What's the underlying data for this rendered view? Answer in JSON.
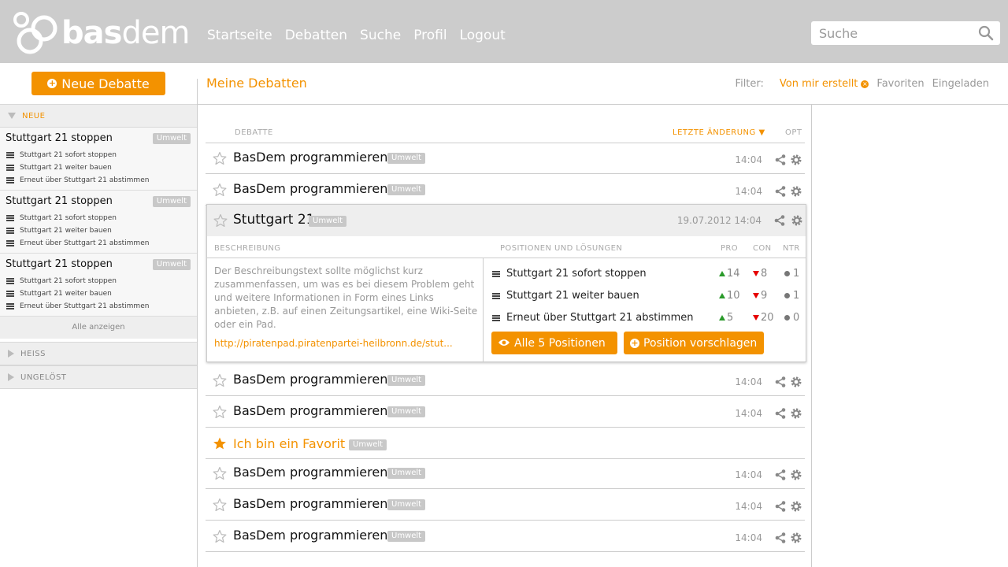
{
  "app": {
    "logo_bold": "bas",
    "logo_light": "dem"
  },
  "nav": [
    "Startseite",
    "Debatten",
    "Suche",
    "Profil",
    "Logout"
  ],
  "search": {
    "placeholder": "Suche"
  },
  "sidebar": {
    "new_button": "Neue Debatte",
    "sections": {
      "neue": "NEUE",
      "heiss": "HEISS",
      "ungeloest": "UNGELÖST"
    },
    "debates": [
      {
        "title": "Stuttgart 21 stoppen",
        "tag": "Umwelt",
        "positions": [
          "Stuttgart 21 sofort stoppen",
          "Stuttgart 21 weiter bauen",
          "Erneut über Stuttgart 21 abstimmen"
        ]
      },
      {
        "title": "Stuttgart 21 stoppen",
        "tag": "Umwelt",
        "positions": [
          "Stuttgart 21 sofort stoppen",
          "Stuttgart 21 weiter bauen",
          "Erneut über Stuttgart 21 abstimmen"
        ]
      },
      {
        "title": "Stuttgart 21 stoppen",
        "tag": "Umwelt",
        "positions": [
          "Stuttgart 21 sofort stoppen",
          "Stuttgart 21 weiter bauen",
          "Erneut über Stuttgart 21 abstimmen"
        ]
      }
    ],
    "show_all": "Alle anzeigen"
  },
  "main": {
    "title": "Meine Debatten",
    "filter": {
      "label": "Filter:",
      "active": "Von mir erstellt",
      "favorites": "Favoriten",
      "invited": "Eingeladen"
    },
    "columns": {
      "debate": "DEBATTE",
      "last_change": "LETZTE ÄNDERUNG",
      "opt": "OPT"
    },
    "rows": [
      {
        "title": "BasDem programmieren",
        "tag": "Umwelt",
        "time": "14:04"
      },
      {
        "title": "BasDem programmieren",
        "tag": "Umwelt",
        "time": "14:04"
      },
      {
        "title": "BasDem programmieren",
        "tag": "Umwelt",
        "time": "14:04"
      },
      {
        "title": "BasDem programmieren",
        "tag": "Umwelt",
        "time": "14:04"
      },
      {
        "title": "Ich bin ein Favorit",
        "tag": "Umwelt",
        "time": ""
      },
      {
        "title": "BasDem programmieren",
        "tag": "Umwelt",
        "time": "14:04"
      },
      {
        "title": "BasDem programmieren",
        "tag": "Umwelt",
        "time": "14:04"
      },
      {
        "title": "BasDem programmieren",
        "tag": "Umwelt",
        "time": "14:04"
      }
    ],
    "expanded": {
      "title": "Stuttgart 21",
      "tag": "Umwelt",
      "time": "19.07.2012 14:04",
      "desc_head": "BESCHREIBUNG",
      "pos_head": "POSITIONEN UND LÖSUNGEN",
      "pro": "PRO",
      "con": "CON",
      "ntr": "NTR",
      "description": "Der Beschreibungstext sollte möglichst kurz zusammenfassen, um was es bei diesem Problem geht und weitere Informationen in Form eines Links anbieten, z.B. auf einen Zeitungsartikel, eine Wiki-Seite oder ein Pad.",
      "link": "http://piratenpad.piratenpartei-heilbronn.de/stut...",
      "positions": [
        {
          "text": "Stuttgart 21 sofort stoppen",
          "pro": "14",
          "con": "8",
          "ntr": "1"
        },
        {
          "text": "Stuttgart 21 weiter bauen",
          "pro": "10",
          "con": "9",
          "ntr": "1"
        },
        {
          "text": "Erneut über Stuttgart 21 abstimmen",
          "pro": "5",
          "con": "20",
          "ntr": "0"
        }
      ],
      "btn_all": "Alle 5 Positionen",
      "btn_suggest": "Position vorschlagen"
    }
  },
  "colors": {
    "accent": "#f39200",
    "header_bg": "#cccccc",
    "pro": "#2a9a2a",
    "con": "#e60000"
  }
}
